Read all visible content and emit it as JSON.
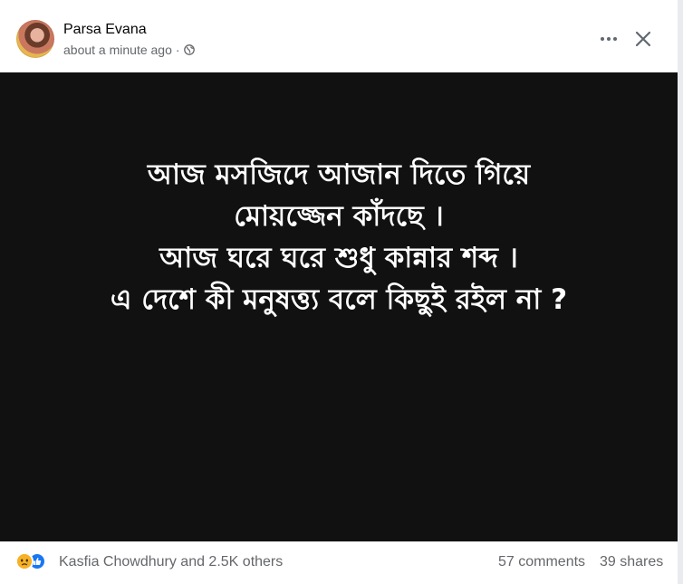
{
  "post": {
    "author": "Parsa Evana",
    "timestamp": "about a minute ago",
    "separator": "·",
    "privacy_icon": "globe-icon",
    "options_icon": "more-horizontal-icon",
    "close_icon": "close-icon"
  },
  "image_text": {
    "lines": [
      "আজ মসজিদে আজান দিতে গিয়ে",
      "মোয়জ্জেন কাঁদছে ।",
      "আজ ঘরে ঘরে শুধু কান্নার শব্দ ।",
      "এ দেশে কী মনুষত্ত্য বলে কিছুই রইল না ?"
    ]
  },
  "footer": {
    "reaction_icons": [
      "sad-reaction-icon",
      "like-reaction-icon"
    ],
    "reactions_text": "Kasfia Chowdhury and 2.5K others",
    "comments": "57 comments",
    "shares": "39 shares"
  },
  "colors": {
    "image_background": "#111111",
    "text_primary": "#050505",
    "text_secondary": "#65676b",
    "like_blue": "#1877f2",
    "sad_yellow": "#f7b125"
  }
}
